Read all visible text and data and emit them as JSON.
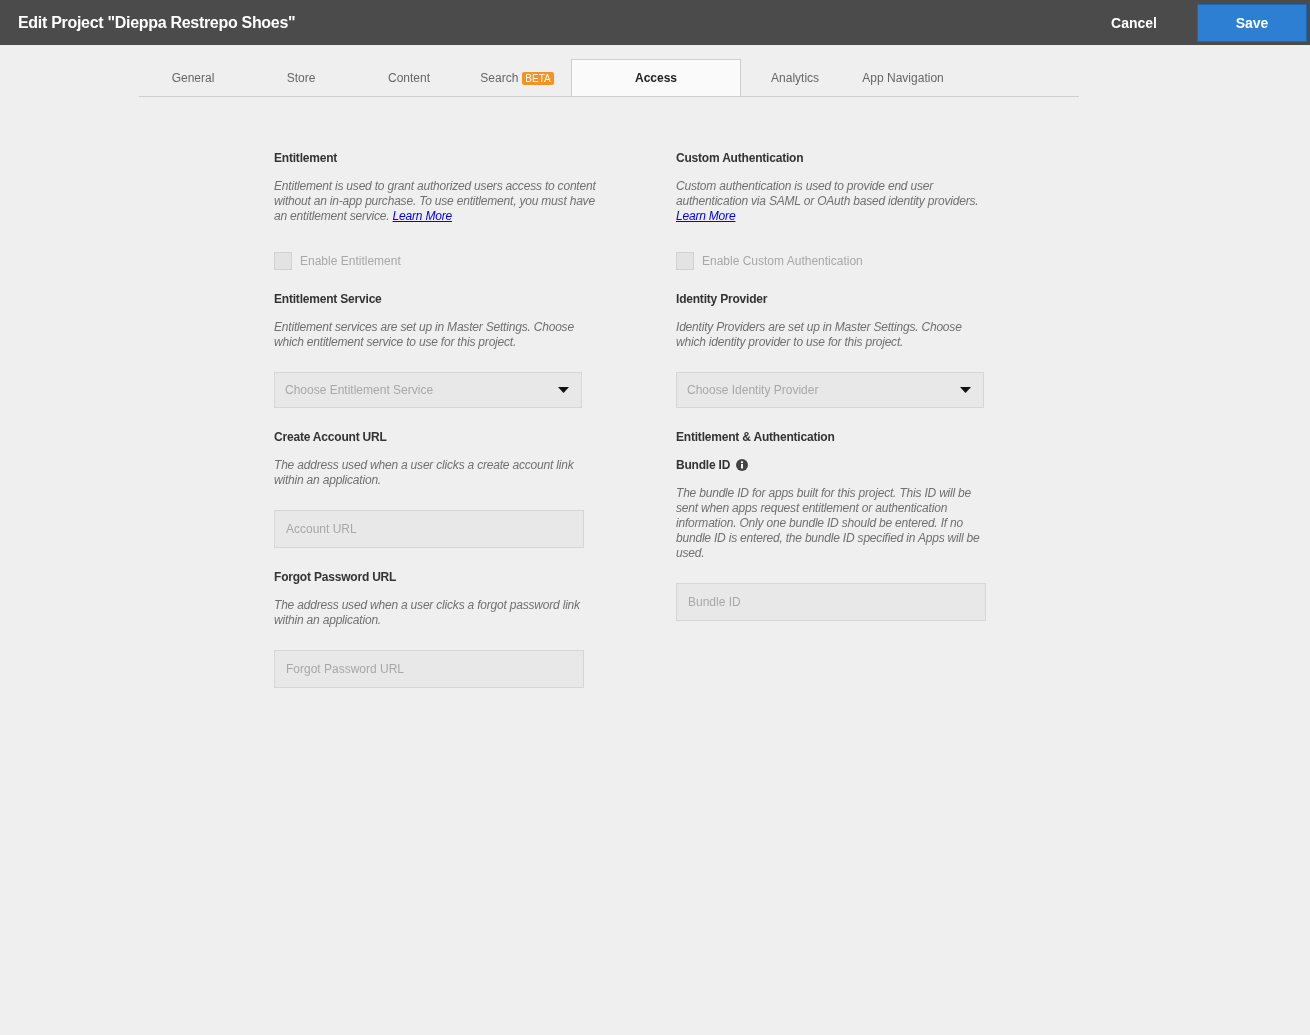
{
  "header": {
    "title": "Edit Project \"Dieppa Restrepo Shoes\"",
    "cancel": "Cancel",
    "save": "Save"
  },
  "tabs": [
    {
      "label": "General",
      "selected": false
    },
    {
      "label": "Store",
      "selected": false
    },
    {
      "label": "Content",
      "selected": false
    },
    {
      "label": "Search",
      "badge": "BETA",
      "selected": false
    },
    {
      "label": "Access",
      "selected": true
    },
    {
      "label": "Analytics",
      "selected": false
    },
    {
      "label": "App Navigation",
      "selected": false
    }
  ],
  "columns": [
    {
      "items": [
        {
          "kind": "heading",
          "text": "Entitlement"
        },
        {
          "kind": "text",
          "text": "Entitlement is used to grant authorized users access to content without an  in-app purchase. To use  entitlement, you must have an entitlement service. ",
          "link": "Learn More"
        },
        {
          "kind": "checkbox",
          "label": "Enable Entitlement",
          "checked": false,
          "disabled": true
        },
        {
          "kind": "heading",
          "text": "Entitlement Service"
        },
        {
          "kind": "text",
          "text": "Entitlement services are set up in Master Settings. Choose which entitlement service to use for this  project."
        },
        {
          "kind": "select",
          "placeholder": "Choose Entitlement Service"
        },
        {
          "kind": "heading",
          "text": "Create Account URL"
        },
        {
          "kind": "text",
          "text": "The address used when a user clicks a create account link within an application."
        },
        {
          "kind": "input",
          "placeholder": "Account URL"
        },
        {
          "kind": "heading",
          "text": "Forgot Password URL"
        },
        {
          "kind": "text",
          "text": "The address used when a user clicks a forgot password link within an application."
        },
        {
          "kind": "input",
          "placeholder": "Forgot Password URL"
        }
      ]
    },
    {
      "items": [
        {
          "kind": "heading",
          "text": "Custom Authentication"
        },
        {
          "kind": "text",
          "text": "Custom authentication is used to provide end user authentication via SAML or OAuth based identity providers. ",
          "link": "Learn More"
        },
        {
          "kind": "checkbox",
          "label": "Enable Custom Authentication",
          "checked": false,
          "disabled": true
        },
        {
          "kind": "heading",
          "text": "Identity Provider"
        },
        {
          "kind": "text",
          "text": "Identity Providers are set up in Master Settings.  Choose which identity provider to use for this project."
        },
        {
          "kind": "select",
          "placeholder": "Choose Identity Provider"
        },
        {
          "kind": "heading",
          "text": "Entitlement & Authentication"
        },
        {
          "kind": "heading",
          "text": "Bundle ID",
          "info": true
        },
        {
          "kind": "text",
          "text": "The bundle ID for apps built for this project. This ID will be sent when apps request entitlement or authentication information. Only one bundle ID should be entered. If no bundle ID is entered, the bundle ID specified in Apps will be used."
        },
        {
          "kind": "input",
          "placeholder": "Bundle ID"
        }
      ]
    }
  ]
}
